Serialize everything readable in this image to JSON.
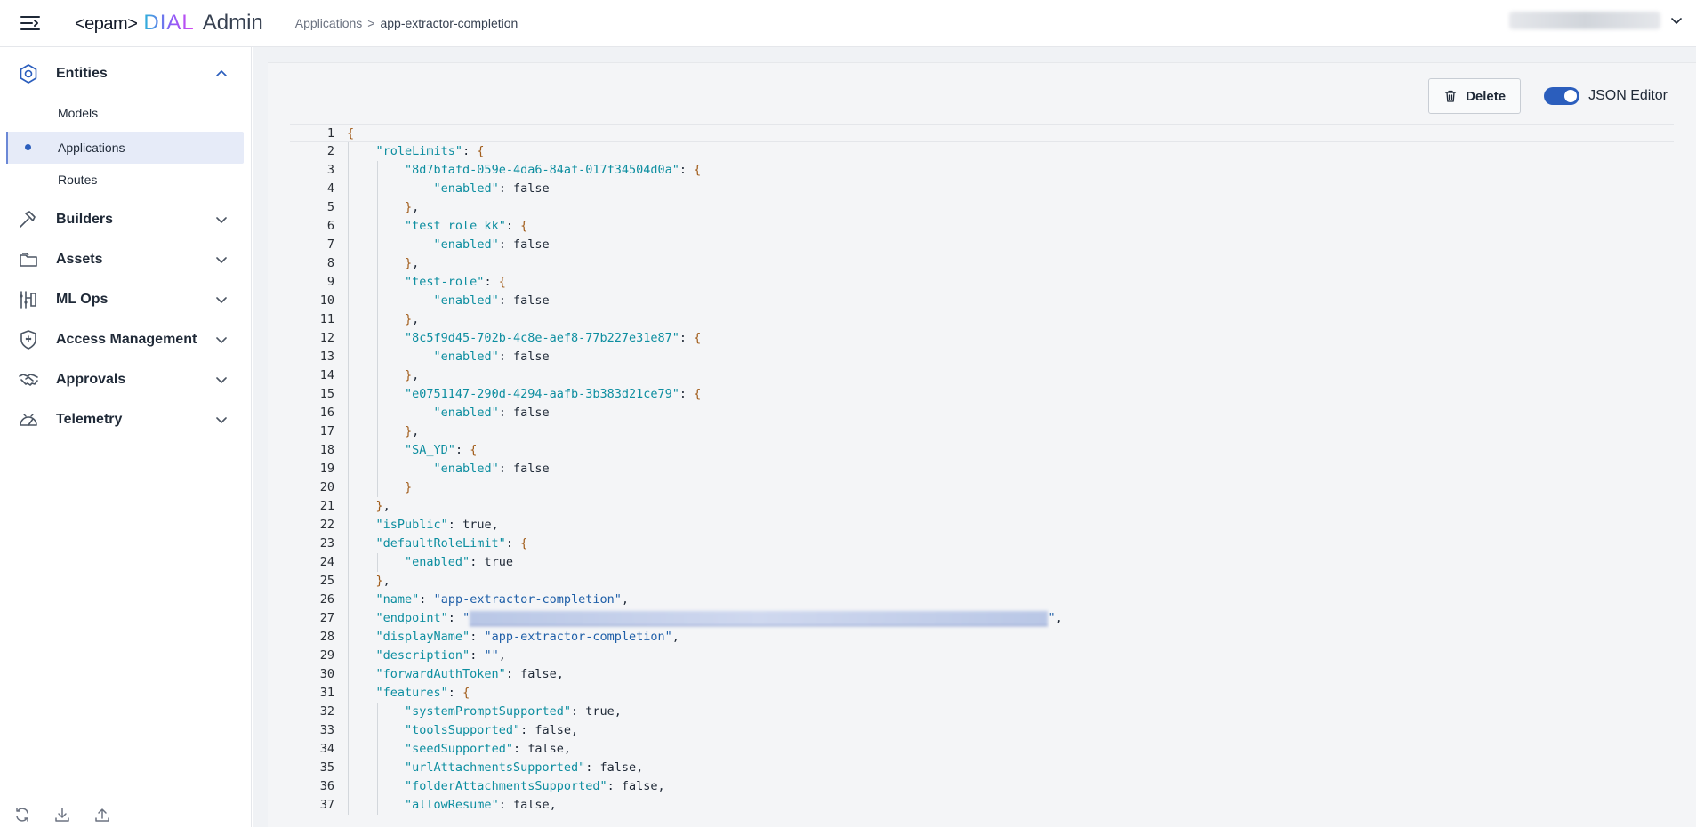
{
  "header": {
    "logo": {
      "brand": "<epam>",
      "product": "DIAL",
      "suffix": "Admin"
    },
    "breadcrumb": {
      "parent": "Applications",
      "separator": ">",
      "current": "app-extractor-completion"
    }
  },
  "sidebar": {
    "groups": [
      {
        "label": "Entities",
        "icon": "hexagon-icon",
        "expanded": true
      },
      {
        "label": "Builders",
        "icon": "hammer-icon",
        "expanded": false
      },
      {
        "label": "Assets",
        "icon": "folder-icon",
        "expanded": false
      },
      {
        "label": "ML Ops",
        "icon": "ml-ops-icon",
        "expanded": false
      },
      {
        "label": "Access Management",
        "icon": "shield-icon",
        "expanded": false
      },
      {
        "label": "Approvals",
        "icon": "handshake-icon",
        "expanded": false
      },
      {
        "label": "Telemetry",
        "icon": "gauge-icon",
        "expanded": false
      }
    ],
    "entities_items": [
      {
        "label": "Models",
        "active": false
      },
      {
        "label": "Applications",
        "active": true
      },
      {
        "label": "Routes",
        "active": false
      }
    ],
    "footer_icons": [
      "refresh-icon",
      "download-icon",
      "upload-icon"
    ]
  },
  "toolbar": {
    "delete_label": "Delete",
    "json_editor_label": "JSON Editor",
    "json_editor_on": true
  },
  "editor": {
    "lines": [
      "{",
      "    \"roleLimits\": {",
      "        \"8d7bfafd-059e-4da6-84af-017f34504d0a\": {",
      "            \"enabled\": false",
      "        },",
      "        \"test role kk\": {",
      "            \"enabled\": false",
      "        },",
      "        \"test-role\": {",
      "            \"enabled\": false",
      "        },",
      "        \"8c5f9d45-702b-4c8e-aef8-77b227e31e87\": {",
      "            \"enabled\": false",
      "        },",
      "        \"e0751147-290d-4294-aafb-3b383d21ce79\": {",
      "            \"enabled\": false",
      "        },",
      "        \"SA_YD\": {",
      "            \"enabled\": false",
      "        }",
      "    },",
      "    \"isPublic\": true,",
      "    \"defaultRoleLimit\": {",
      "        \"enabled\": true",
      "    },",
      "    \"name\": \"app-extractor-completion\",",
      "    \"endpoint\": \"████████████████████████████████████████████████████████████████████████████████\",",
      "    \"displayName\": \"app-extractor-completion\",",
      "    \"description\": \"\",",
      "    \"forwardAuthToken\": false,",
      "    \"features\": {",
      "        \"systemPromptSupported\": true,",
      "        \"toolsSupported\": false,",
      "        \"seedSupported\": false,",
      "        \"urlAttachmentsSupported\": false,",
      "        \"folderAttachmentsSupported\": false,",
      "        \"allowResume\": false,"
    ]
  }
}
